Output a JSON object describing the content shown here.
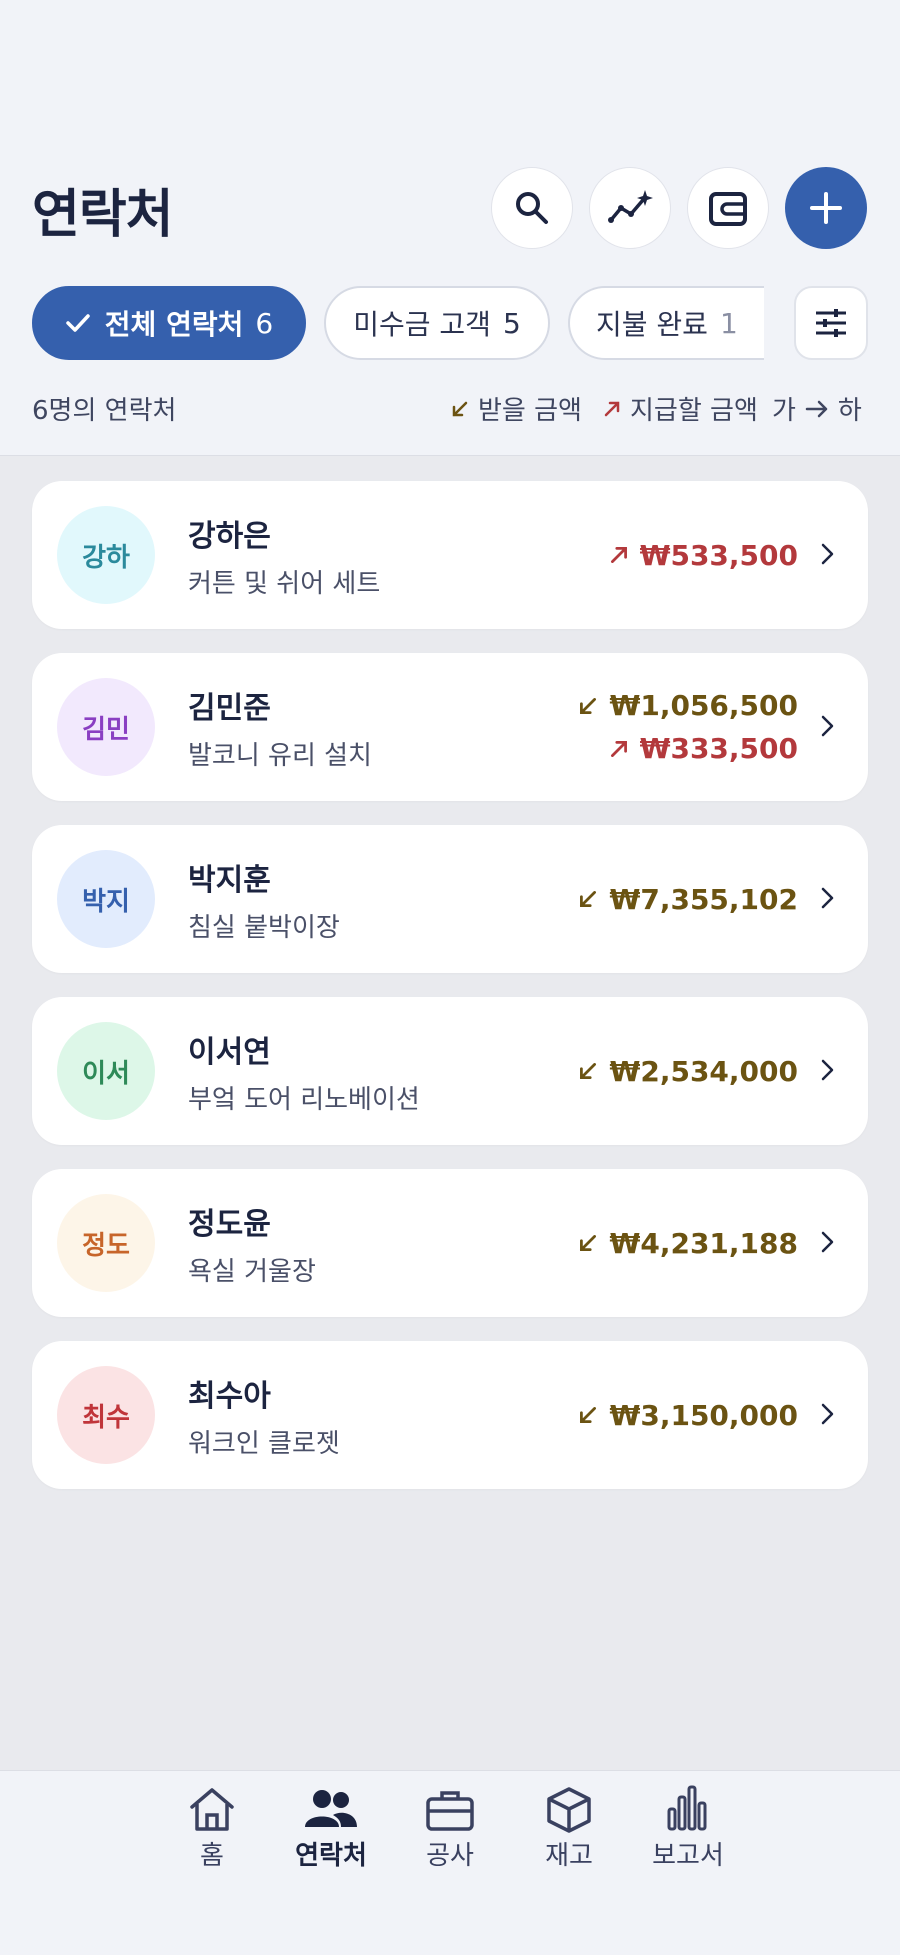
{
  "header": {
    "title": "연락처",
    "buttons": [
      {
        "name": "search",
        "icon": "search-icon"
      },
      {
        "name": "insights",
        "icon": "sparkline-icon"
      },
      {
        "name": "wallet",
        "icon": "wallet-icon"
      },
      {
        "name": "add",
        "icon": "plus-icon"
      }
    ]
  },
  "filters": {
    "chips": [
      {
        "label": "전체 연락처",
        "count": "6",
        "active": true
      },
      {
        "label": "미수금 고객",
        "count": "5",
        "active": false
      },
      {
        "label": "지불 완료",
        "count": "1",
        "active": false
      }
    ],
    "filter_icon": "sliders-icon"
  },
  "summary": {
    "count_text": "6명의 연락처",
    "legend_receive": "받을 금액",
    "legend_pay": "지급할 금액",
    "sort_from": "가",
    "sort_to": "하"
  },
  "contacts": [
    {
      "initials": "강하",
      "name": "강하은",
      "desc": "커튼 및 쉬어 세트",
      "receive": "",
      "pay": "₩533,500",
      "avatar_bg": "#e1f8fc",
      "avatar_fg": "#2b8a9c"
    },
    {
      "initials": "김민",
      "name": "김민준",
      "desc": "발코니 유리 설치",
      "receive": "₩1,056,500",
      "pay": "₩333,500",
      "avatar_bg": "#f2e9fd",
      "avatar_fg": "#8a3fc2"
    },
    {
      "initials": "박지",
      "name": "박지훈",
      "desc": "침실 붙박이장",
      "receive": "₩7,355,102",
      "pay": "",
      "avatar_bg": "#e2ecfd",
      "avatar_fg": "#3560ad"
    },
    {
      "initials": "이서",
      "name": "이서연",
      "desc": "부엌 도어 리노베이션",
      "receive": "₩2,534,000",
      "pay": "",
      "avatar_bg": "#ddf7e8",
      "avatar_fg": "#2e8a58"
    },
    {
      "initials": "정도",
      "name": "정도윤",
      "desc": "욕실 거울장",
      "receive": "₩4,231,188",
      "pay": "",
      "avatar_bg": "#fdf5e8",
      "avatar_fg": "#c7652a"
    },
    {
      "initials": "최수",
      "name": "최수아",
      "desc": "워크인 클로젯",
      "receive": "₩3,150,000",
      "pay": "",
      "avatar_bg": "#fbe3e4",
      "avatar_fg": "#c0353a"
    }
  ],
  "nav": {
    "items": [
      {
        "label": "홈",
        "icon": "home-icon",
        "active": false
      },
      {
        "label": "연락처",
        "icon": "people-icon",
        "active": true
      },
      {
        "label": "공사",
        "icon": "briefcase-icon",
        "active": false
      },
      {
        "label": "재고",
        "icon": "box-icon",
        "active": false
      },
      {
        "label": "보고서",
        "icon": "bar-chart-icon",
        "active": false
      }
    ]
  },
  "colors": {
    "accent": "#3560ad",
    "receive": "#6b5312",
    "pay": "#b3393c"
  }
}
